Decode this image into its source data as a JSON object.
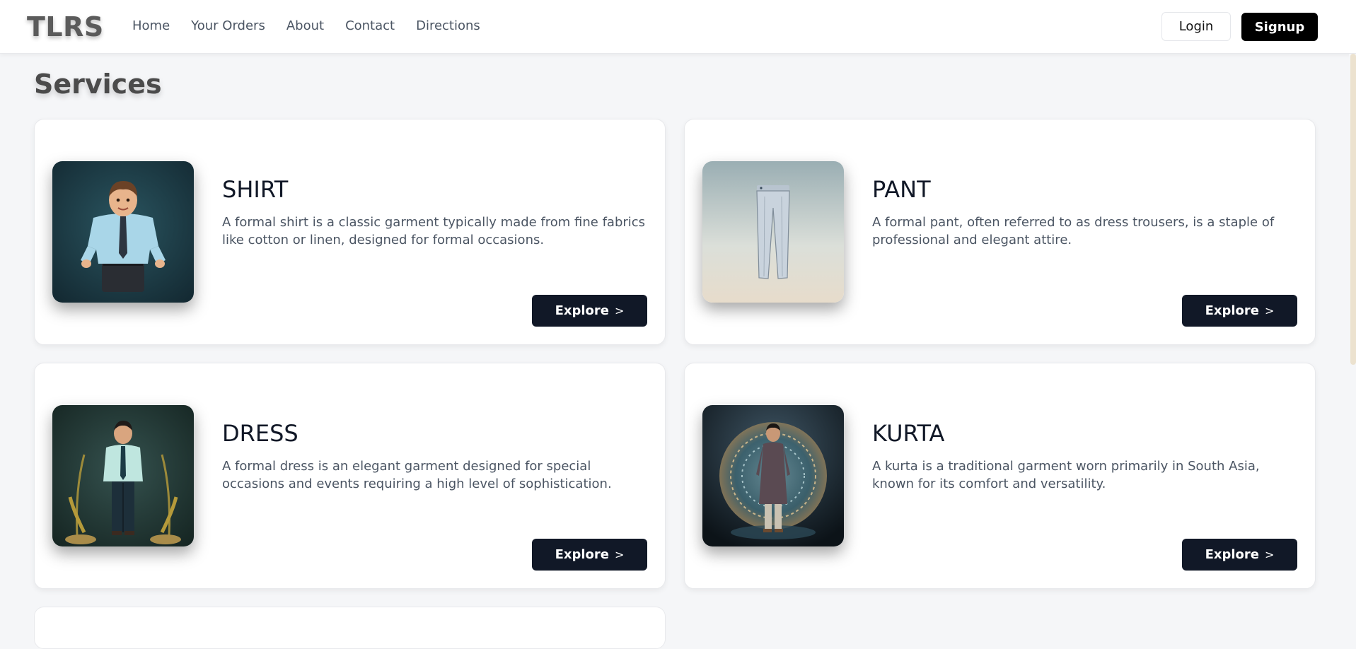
{
  "header": {
    "logo": "TLRS",
    "nav": [
      "Home",
      "Your Orders",
      "About",
      "Contact",
      "Directions"
    ],
    "login_label": "Login",
    "signup_label": "Signup"
  },
  "main": {
    "title": "Services",
    "cards": [
      {
        "title": "SHIRT",
        "description": "A formal shirt is a classic garment typically made from fine fabrics like cotton or linen, designed for formal occasions.",
        "button": "Explore",
        "chevron": ">"
      },
      {
        "title": "PANT",
        "description": "A formal pant, often referred to as dress trousers, is a staple of professional and elegant attire.",
        "button": "Explore",
        "chevron": ">"
      },
      {
        "title": "DRESS",
        "description": "A formal dress is an elegant garment designed for special occasions and events requiring a high level of sophistication.",
        "button": "Explore",
        "chevron": ">"
      },
      {
        "title": "KURTA",
        "description": "A kurta is a traditional garment worn primarily in South Asia, known for its comfort and versatility.",
        "button": "Explore",
        "chevron": ">"
      }
    ]
  }
}
